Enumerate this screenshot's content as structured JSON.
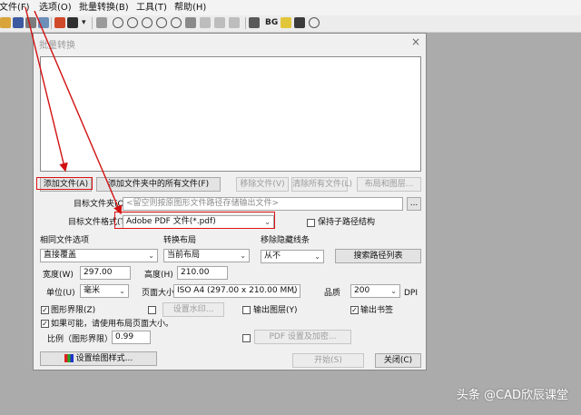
{
  "menubar": {
    "items": [
      "文件(F)",
      "选项(O)",
      "批量转换(B)",
      "工具(T)",
      "帮助(H)"
    ]
  },
  "toolbar": {
    "bg_label": "BG"
  },
  "dialog": {
    "title": "批量转换",
    "close_glyph": "×",
    "add_file_button": "添加文件(A)",
    "add_all_button": "添加文件夹中的所有文件(F)",
    "remove_file_button": "移除文件(V)",
    "remove_all_button": "清除所有文件(L)",
    "layout_button": "布局和图层...",
    "target_folder_label": "目标文件夹(O)",
    "target_folder_placeholder": "<留空则按原图形文件路径存储输出文件>",
    "browse_button": "...",
    "target_format_label": "目标文件格式(T)",
    "target_format_value": "Adobe PDF 文件(*.pdf)",
    "keep_subdir_label": "保持子路径结构",
    "same_file_label": "相同文件选项",
    "same_file_value": "直接覆盖",
    "convert_layout_label": "转换布局",
    "convert_layout_value": "当前布局",
    "hidden_lines_label": "移除隐藏线条",
    "hidden_lines_value": "从不",
    "search_path_button": "搜索路径列表",
    "width_label": "宽度(W)",
    "width_value": "297.00",
    "height_label": "高度(H)",
    "height_value": "210.00",
    "unit_label": "单位(U)",
    "unit_value": "毫米",
    "page_size_label": "页面大小",
    "page_size_value": "ISO A4 (297.00 x 210.00 MM)",
    "quality_label": "品质",
    "quality_value": "200",
    "dpi_label": "DPI",
    "extents_label": "图形界限(Z)",
    "watermark_button": "设置水印...",
    "output_layers_label": "输出图层(Y)",
    "output_bookmarks_label": "输出书签",
    "use_layout_size_label": "如果可能，请使用布局页面大小。",
    "scale_label": "比例（图形界限）",
    "scale_value": "0.99",
    "pdf_encrypt_button": "PDF 设置及加密...",
    "plot_style_button": "设置绘图样式...",
    "start_button": "开始(S)",
    "close_button": "关闭(C)"
  },
  "watermark_text": "头条 @CAD欣辰课堂",
  "colors": {
    "annotation_red": "#d11111"
  }
}
